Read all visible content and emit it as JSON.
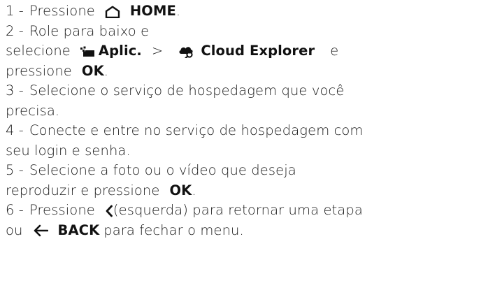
{
  "steps": [
    {
      "num": "1 -",
      "parts": {
        "a": "Pressione",
        "home_label": "HOME",
        "end": "."
      }
    },
    {
      "num": "2 -",
      "parts": {
        "a": "Role para baixo e",
        "b": "selecione",
        "apps_label": "Aplic.",
        "sep": ">",
        "cloud_label": "Cloud Explorer",
        "c": "e",
        "d": "pressione",
        "ok_label": "OK",
        "end": "."
      }
    },
    {
      "num": "3 -",
      "parts": {
        "a": "Selecione o serviço de hospedagem que você",
        "b": "precisa."
      }
    },
    {
      "num": "4 -",
      "parts": {
        "a": "Conecte e entre no serviço de hospedagem com",
        "b": "seu login e senha."
      }
    },
    {
      "num": "5 -",
      "parts": {
        "a": "Selecione a foto ou o vídeo que deseja",
        "b": "reproduzir e pressione",
        "ok_label": "OK",
        "end": "."
      }
    },
    {
      "num": "6 -",
      "parts": {
        "a": "Pressione",
        "left_label": "(esquerda) para retornar uma etapa",
        "b": "ou",
        "back_label": "BACK",
        "c": "para fechar o menu."
      }
    }
  ],
  "icons": {
    "home": "home-icon",
    "apps": "apps-icon",
    "cloud": "cloud-explorer-icon",
    "left": "chevron-left-icon",
    "back": "back-arrow-icon"
  }
}
